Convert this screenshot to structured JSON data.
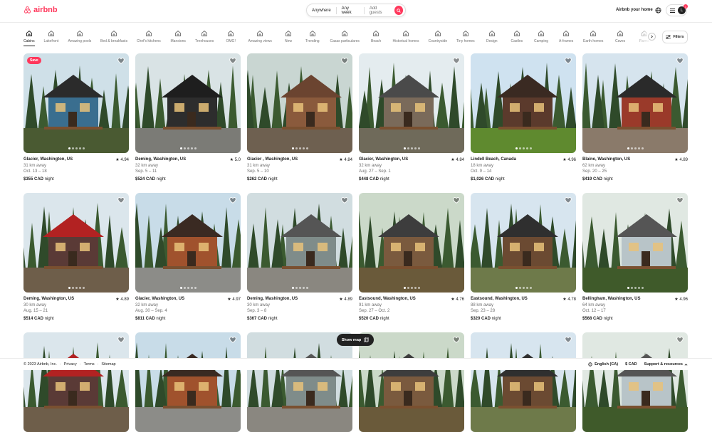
{
  "colors": {
    "brand": "#ff385c",
    "text": "#222222",
    "muted": "#717171"
  },
  "header": {
    "logo_text": "airbnb",
    "search": {
      "anywhere": "Anywhere",
      "any_week": "Any week",
      "add_guests": "Add guests"
    },
    "host_link": "Airbnb your home",
    "avatar_initial": "L",
    "notif_count": "1"
  },
  "categories": [
    "Cabins",
    "Lakefront",
    "Amazing pools",
    "Bed & breakfasts",
    "Chef's kitchens",
    "Mansions",
    "Treehouses",
    "OMG!",
    "Amazing views",
    "New",
    "Trending",
    "Casas particulares",
    "Beach",
    "Historical homes",
    "Countryside",
    "Tiny homes",
    "Design",
    "Castles",
    "Camping",
    "A-frames",
    "Earth homes",
    "Caves",
    "Farms"
  ],
  "filters_label": "Filters",
  "listings": [
    {
      "loc": "Glacier, Washington, US",
      "rating": "4.94",
      "dist": "31 km away",
      "dates": "Oct. 13 – 18",
      "price": "$355 CAD",
      "unit": "night",
      "badge": "Save"
    },
    {
      "loc": "Deming, Washington, US",
      "rating": "5.0",
      "dist": "32 km away",
      "dates": "Sep. 5 – 11",
      "price": "$524 CAD",
      "unit": "night"
    },
    {
      "loc": "Glacier , Washington, US",
      "rating": "4.84",
      "dist": "31 km away",
      "dates": "Sep. 5 – 10",
      "price": "$262 CAD",
      "unit": "night"
    },
    {
      "loc": "Glacier, Washington, US",
      "rating": "4.84",
      "dist": "32 km away",
      "dates": "Aug. 27 – Sep. 1",
      "price": "$448 CAD",
      "unit": "night"
    },
    {
      "loc": "Lindell Beach, Canada",
      "rating": "4.96",
      "dist": "18 km away",
      "dates": "Oct. 9 – 14",
      "price": "$1,026 CAD",
      "unit": "night"
    },
    {
      "loc": "Blaine, Washington, US",
      "rating": "4.89",
      "dist": "62 km away",
      "dates": "Sep. 20 – 25",
      "price": "$419 CAD",
      "unit": "night"
    },
    {
      "loc": "Deming, Washington, US",
      "rating": "4.89",
      "dist": "30 km away",
      "dates": "Aug. 15 – 21",
      "price": "$514 CAD",
      "unit": "night"
    },
    {
      "loc": "Glacier, Washington, US",
      "rating": "4.97",
      "dist": "32 km away",
      "dates": "Aug. 30 – Sep. 4",
      "price": "$811 CAD",
      "unit": "night"
    },
    {
      "loc": "Deming, Washington, US",
      "rating": "4.89",
      "dist": "30 km away",
      "dates": "Sep. 3 – 8",
      "price": "$367 CAD",
      "unit": "night"
    },
    {
      "loc": "Eastsound, Washington, US",
      "rating": "4.76",
      "dist": "91 km away",
      "dates": "Sep. 27 – Oct. 2",
      "price": "$520 CAD",
      "unit": "night"
    },
    {
      "loc": "Eastsound, Washington, US",
      "rating": "4.78",
      "dist": "88 km away",
      "dates": "Sep. 23 – 28",
      "price": "$320 CAD",
      "unit": "night"
    },
    {
      "loc": "Bellingham, Washington, US",
      "rating": "4.96",
      "dist": "64 km away",
      "dates": "Oct. 12 – 17",
      "price": "$568 CAD",
      "unit": "night"
    }
  ],
  "show_map": "Show map",
  "footer": {
    "copyright": "© 2023 Airbnb, Inc.",
    "sep": "·",
    "privacy": "Privacy",
    "terms": "Terms",
    "sitemap": "Sitemap",
    "language": "English (CA)",
    "currency": "$ CAD",
    "support": "Support & resources"
  }
}
